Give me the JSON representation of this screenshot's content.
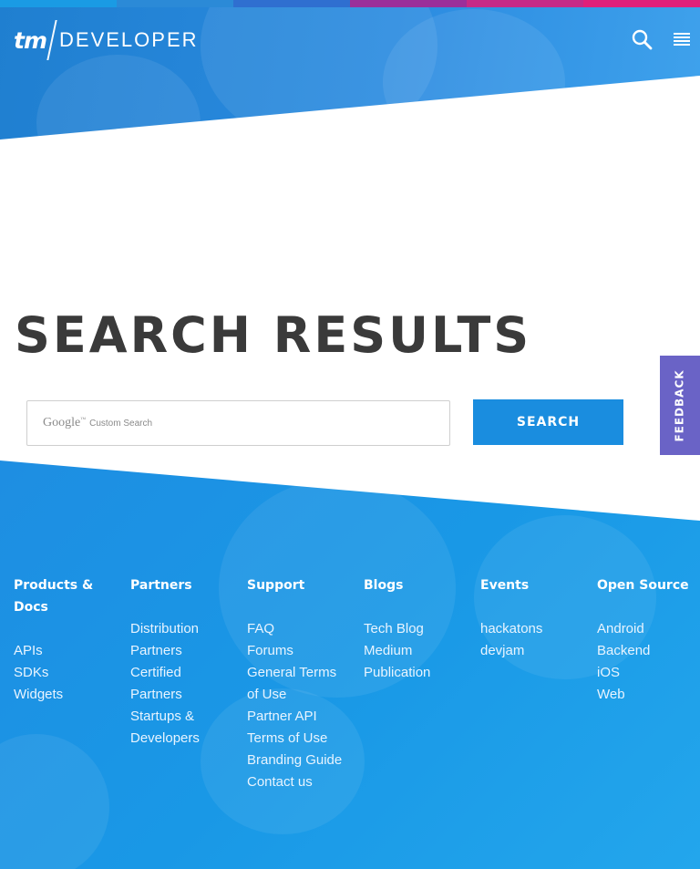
{
  "topbar_colors": [
    "#1a9be4",
    "#2b8ad7",
    "#2f6fd0",
    "#9b2f9a",
    "#c62a87",
    "#e0207a"
  ],
  "header": {
    "logo_mark": "tm",
    "logo_text": "DEVELOPER",
    "search_icon": "search-icon",
    "menu_icon": "hamburger-menu-icon"
  },
  "main": {
    "title": "SEARCH RESULTS",
    "search": {
      "brand": "Google",
      "brand_tm": "™",
      "placeholder": "Custom Search",
      "button_label": "SEARCH"
    }
  },
  "feedback": {
    "label": "FEEDBACK"
  },
  "footer": {
    "columns": [
      {
        "heading": "Products & Docs",
        "links": [
          "APIs",
          "SDKs",
          "Widgets"
        ]
      },
      {
        "heading": "Partners",
        "links": [
          "Distribution Partners",
          "Certified Partners",
          "Startups & Developers"
        ]
      },
      {
        "heading": "Support",
        "links": [
          "FAQ",
          "Forums",
          "General Terms of Use",
          "Partner API Terms of Use",
          "Branding Guide",
          "Contact us"
        ]
      },
      {
        "heading": "Blogs",
        "links": [
          "Tech Blog",
          "Medium Publication"
        ]
      },
      {
        "heading": "Events",
        "links": [
          "hackatons",
          "devjam"
        ]
      },
      {
        "heading": "Open Source",
        "links": [
          "Android",
          "Backend",
          "iOS",
          "Web"
        ]
      }
    ]
  },
  "colors": {
    "brand_blue": "#1a8ddf",
    "feedback": "#6a63c6",
    "title": "#3a3a3a"
  }
}
